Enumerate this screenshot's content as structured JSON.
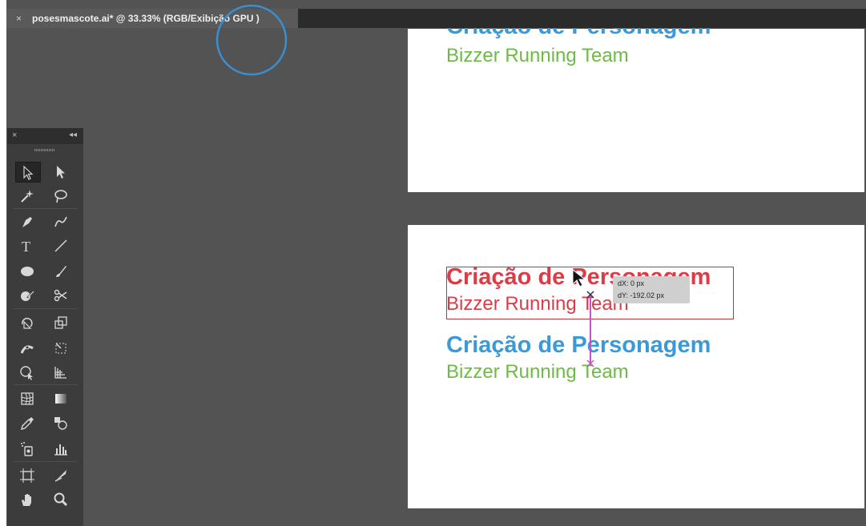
{
  "document_tab": {
    "close_glyph": "×",
    "title": "posesmascote.ai* @ 33.33% (RGB/Exibição GPU )"
  },
  "canvas": {
    "artboard_top": {
      "title_partial": "Criação de Personagem",
      "subtitle": "Bizzer Running Team"
    },
    "artboard_bottom": {
      "selected_title": "Criação de Personagem",
      "selected_subtitle": "Bizzer Running Team",
      "copy_title": "Criação de Personagem",
      "copy_subtitle": "Bizzer Running Team"
    },
    "move_tooltip": {
      "dx": "dX: 0 px",
      "dy": "dY: -192.02 px"
    }
  },
  "tools_panel": {
    "close_glyph": "×",
    "collapse_glyph": "◂◂",
    "tools": [
      {
        "name": "selection-tool",
        "icon": "arrow-outline-icon",
        "selected": true
      },
      {
        "name": "direct-selection-tool",
        "icon": "arrow-filled-icon"
      },
      {
        "name": "magic-wand-tool",
        "icon": "magic-wand-icon"
      },
      {
        "name": "lasso-tool",
        "icon": "lasso-icon"
      },
      {
        "name": "pen-tool",
        "icon": "pen-icon"
      },
      {
        "name": "curvature-tool",
        "icon": "curvature-pen-icon"
      },
      {
        "name": "type-tool",
        "icon": "type-icon",
        "glyph": "T"
      },
      {
        "name": "line-segment-tool",
        "icon": "line-icon"
      },
      {
        "name": "ellipse-tool",
        "icon": "ellipse-icon"
      },
      {
        "name": "paintbrush-tool",
        "icon": "brush-icon"
      },
      {
        "name": "shaper-tool",
        "icon": "shaper-icon"
      },
      {
        "name": "scissors-tool",
        "icon": "scissors-icon"
      },
      {
        "name": "rotate-tool",
        "icon": "rotate-icon"
      },
      {
        "name": "scale-tool",
        "icon": "scale-icon"
      },
      {
        "name": "width-tool",
        "icon": "width-icon"
      },
      {
        "name": "free-transform-tool",
        "icon": "free-transform-icon"
      },
      {
        "name": "shape-builder-tool",
        "icon": "shape-builder-icon"
      },
      {
        "name": "perspective-grid-tool",
        "icon": "perspective-grid-icon"
      },
      {
        "name": "mesh-tool",
        "icon": "mesh-icon"
      },
      {
        "name": "gradient-tool",
        "icon": "gradient-icon"
      },
      {
        "name": "eyedropper-tool",
        "icon": "eyedropper-icon"
      },
      {
        "name": "blend-tool",
        "icon": "blend-icon"
      },
      {
        "name": "symbol-sprayer-tool",
        "icon": "symbol-sprayer-icon"
      },
      {
        "name": "column-graph-tool",
        "icon": "column-graph-icon"
      },
      {
        "name": "artboard-tool",
        "icon": "artboard-icon"
      },
      {
        "name": "slice-tool",
        "icon": "slice-icon"
      },
      {
        "name": "hand-tool",
        "icon": "hand-icon"
      },
      {
        "name": "zoom-tool",
        "icon": "zoom-icon"
      }
    ]
  },
  "colors": {
    "workspace": "#535353",
    "panel": "#3c3c3c",
    "title_blue": "#3a9ad9",
    "subtitle_green": "#6dbb45",
    "selection_red": "#dc3c46",
    "smart_guide": "#c054c8"
  }
}
